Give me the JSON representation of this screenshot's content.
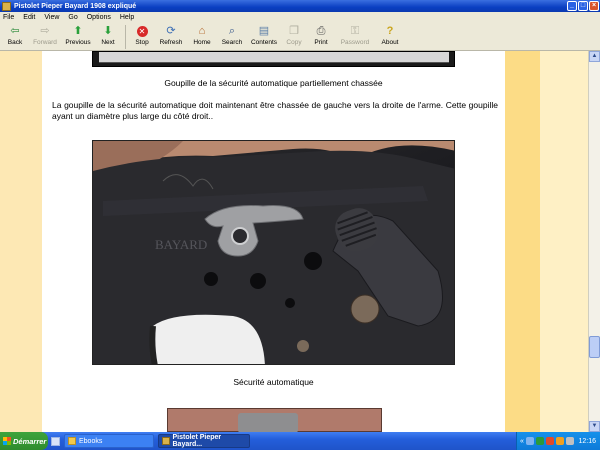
{
  "window": {
    "title": "Pistolet Pieper Bayard 1908 expliqué"
  },
  "menu": {
    "items": [
      "File",
      "Edit",
      "View",
      "Go",
      "Options",
      "Help"
    ]
  },
  "toolbar": {
    "back": "Back",
    "forward": "Forward",
    "previous": "Previous",
    "next": "Next",
    "stop": "Stop",
    "refresh": "Refresh",
    "home": "Home",
    "search": "Search",
    "contents": "Contents",
    "copy": "Copy",
    "print": "Print",
    "password": "Password",
    "about": "About"
  },
  "page": {
    "caption_top": "Goupille de la sécurité automatique partiellement chassée",
    "paragraph": "La goupille de la sécurité automatique doit maintenant être chassée de gauche vers la droite de l'arme. Cette goupille ayant un diamètre plus large du côté droit..",
    "caption_main": "Sécurité automatique",
    "photo_engraving": "BAYARD"
  },
  "taskbar": {
    "start": "Démarrer",
    "task1": "Ebooks",
    "task2": "Pistolet Pieper Bayard...",
    "clock": "12:16",
    "tray_chevron": "«"
  },
  "colors": {
    "band_left": "#fde8b4",
    "band_right": "#fcdc86",
    "band_far_right": "#fef0c5",
    "titlebar": "#0a3fc2",
    "taskbar": "#245edb",
    "start": "#2f8c2e"
  }
}
